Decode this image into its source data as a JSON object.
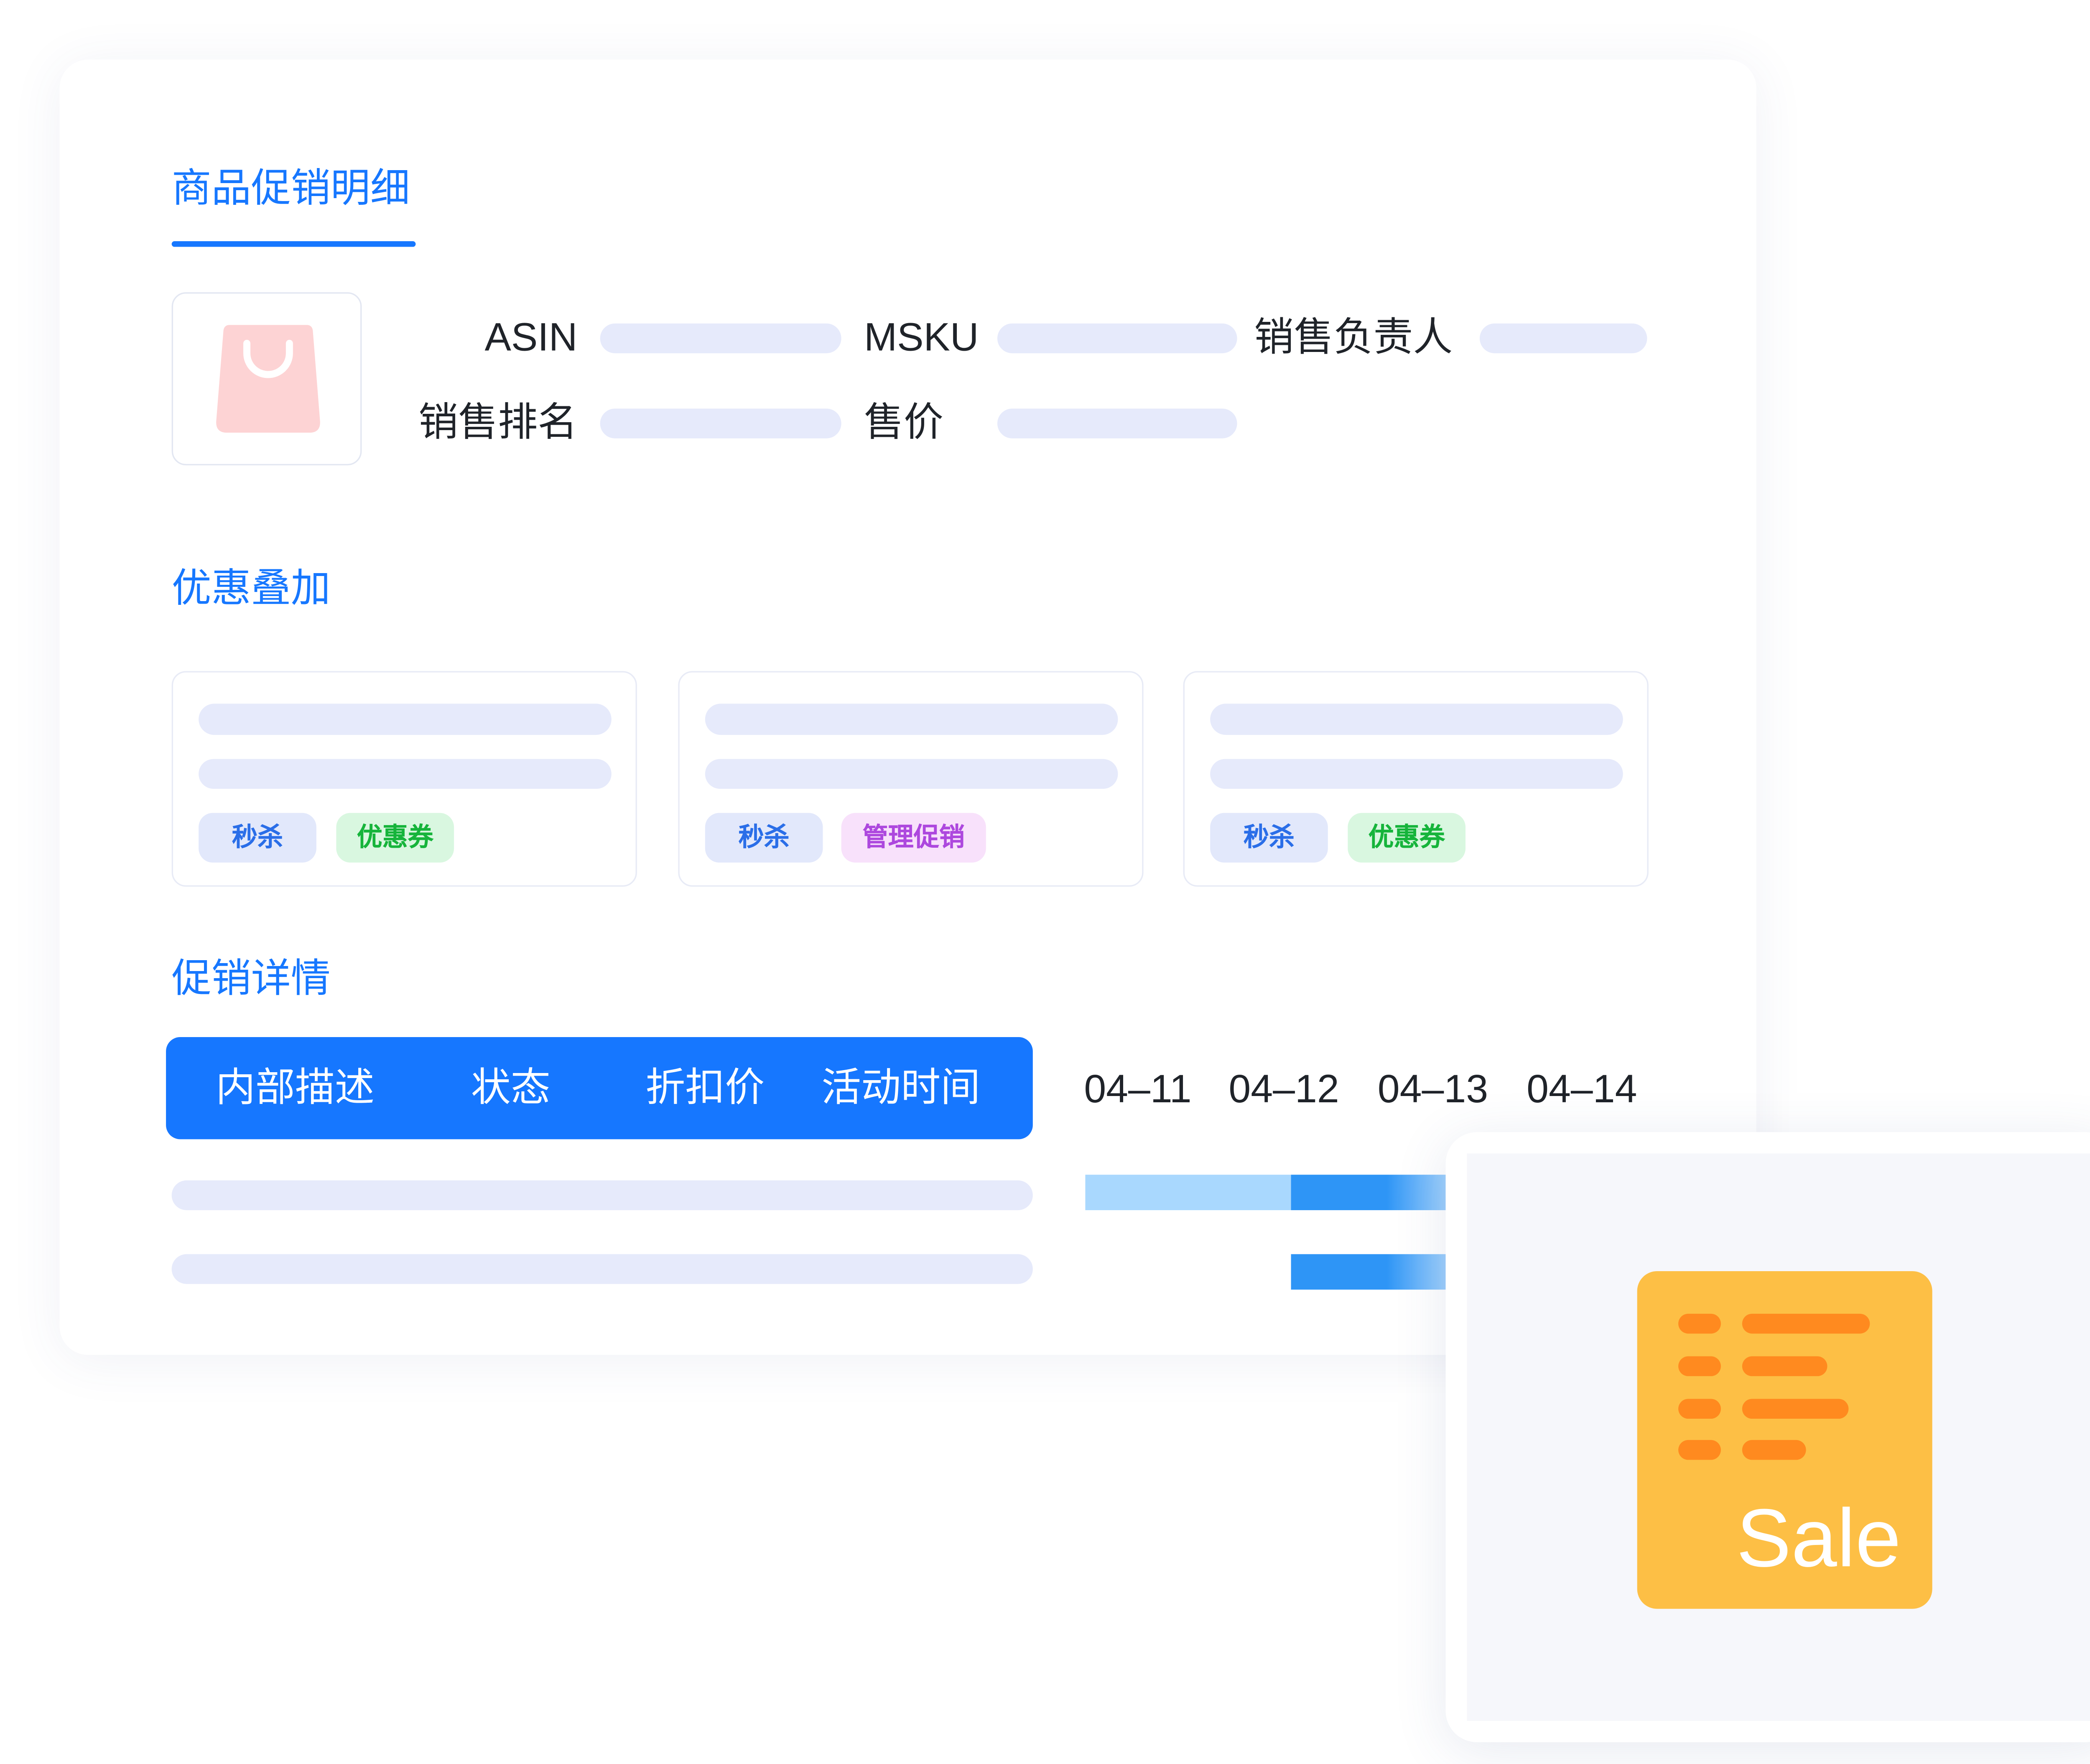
{
  "colors": {
    "primary": "#1677ff",
    "skeleton": "#e6eafb",
    "text": "#1f2329",
    "bag": "#fdd3d4",
    "sale_bg": "#fdbf45",
    "sale_lines": "#ff8a1f"
  },
  "detail": {
    "tab_title": "商品促销明细",
    "product_icon": "shopping-bag-icon",
    "fields": {
      "asin": "ASIN",
      "msku": "MSKU",
      "sales_owner": "销售负责人",
      "sales_rank": "销售排名",
      "price": "售价"
    }
  },
  "stacking": {
    "title": "优惠叠加",
    "cards": [
      {
        "tags": [
          "秒杀",
          "优惠券"
        ]
      },
      {
        "tags": [
          "秒杀",
          "管理促销"
        ]
      },
      {
        "tags": [
          "秒杀",
          "优惠券"
        ]
      }
    ]
  },
  "promo_detail": {
    "title": "促销详情",
    "columns": [
      "内部描述",
      "状态",
      "折扣价",
      "活动时间"
    ],
    "dates": [
      "04–11",
      "04–12",
      "04–13",
      "04–14"
    ]
  },
  "sale_badge": {
    "icon": "sale-document-icon",
    "label": "Sale"
  }
}
